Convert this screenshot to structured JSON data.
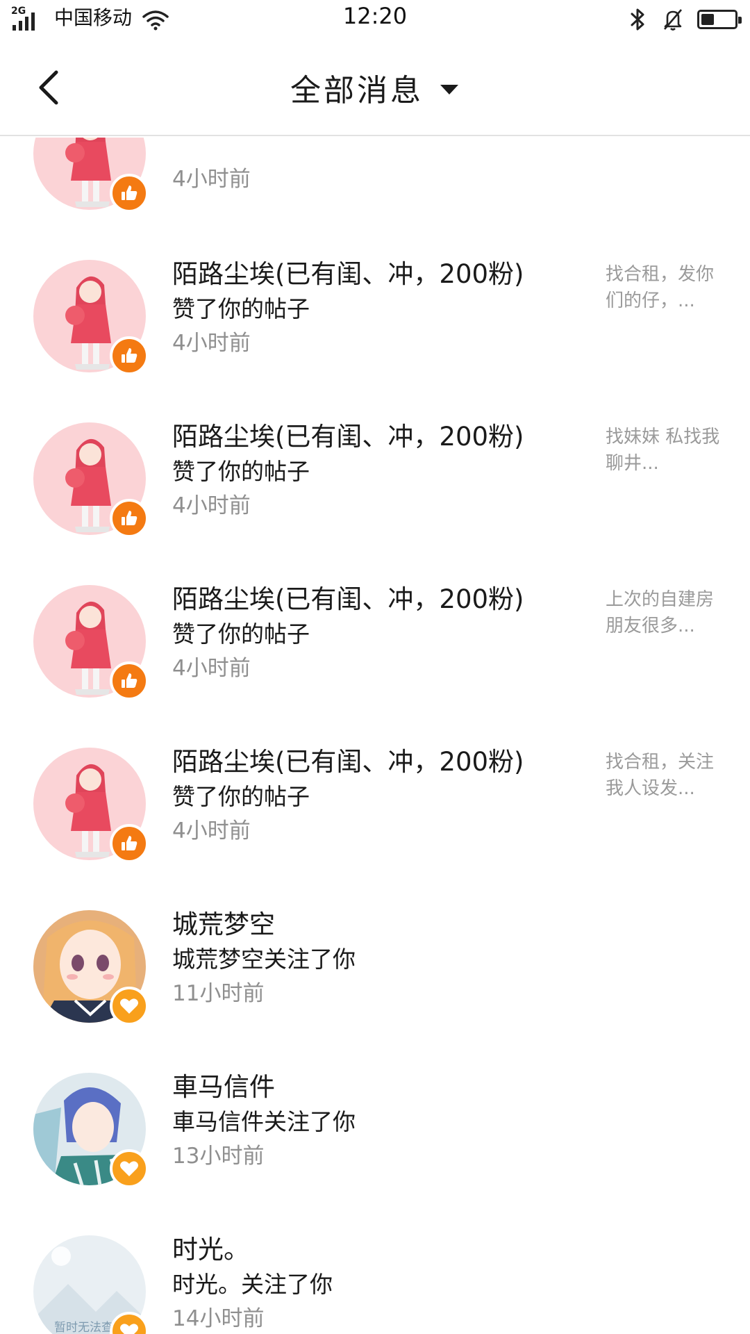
{
  "status_bar": {
    "network": "2G",
    "carrier": "中国移动",
    "time": "12:20",
    "battery_level": 0.4
  },
  "nav": {
    "title": "全部消息",
    "back_icon": "chevron-left-icon",
    "dropdown_icon": "caret-down-icon"
  },
  "colors": {
    "like_badge": "#f47a12",
    "follow_badge": "#f9a01c",
    "time_text": "#8f8f8f",
    "preview_text": "#9a9a9a"
  },
  "messages": [
    {
      "type": "like",
      "name": "",
      "action": "",
      "time": "4小时前",
      "preview": ""
    },
    {
      "type": "like",
      "name": "陌路尘埃(已有闺、冲，200粉)",
      "action": "赞了你的帖子",
      "time": "4小时前",
      "preview": "找合租，发你们的仔，..."
    },
    {
      "type": "like",
      "name": "陌路尘埃(已有闺、冲，200粉)",
      "action": "赞了你的帖子",
      "time": "4小时前",
      "preview": "找妹妹 私找我聊井..."
    },
    {
      "type": "like",
      "name": "陌路尘埃(已有闺、冲，200粉)",
      "action": "赞了你的帖子",
      "time": "4小时前",
      "preview": "上次的自建房朋友很多..."
    },
    {
      "type": "like",
      "name": "陌路尘埃(已有闺、冲，200粉)",
      "action": "赞了你的帖子",
      "time": "4小时前",
      "preview": "找合租，关注我人设发..."
    },
    {
      "type": "follow",
      "name": "城荒梦空",
      "action": "城荒梦空关注了你",
      "time": "11小时前",
      "preview": ""
    },
    {
      "type": "follow",
      "name": "車马信件",
      "action": "車马信件关注了你",
      "time": "13小时前",
      "preview": ""
    },
    {
      "type": "follow",
      "name": "时光。",
      "action": "时光。关注了你",
      "time": "14小时前",
      "preview": "",
      "avatar_placeholder": "暂时无法查"
    }
  ]
}
